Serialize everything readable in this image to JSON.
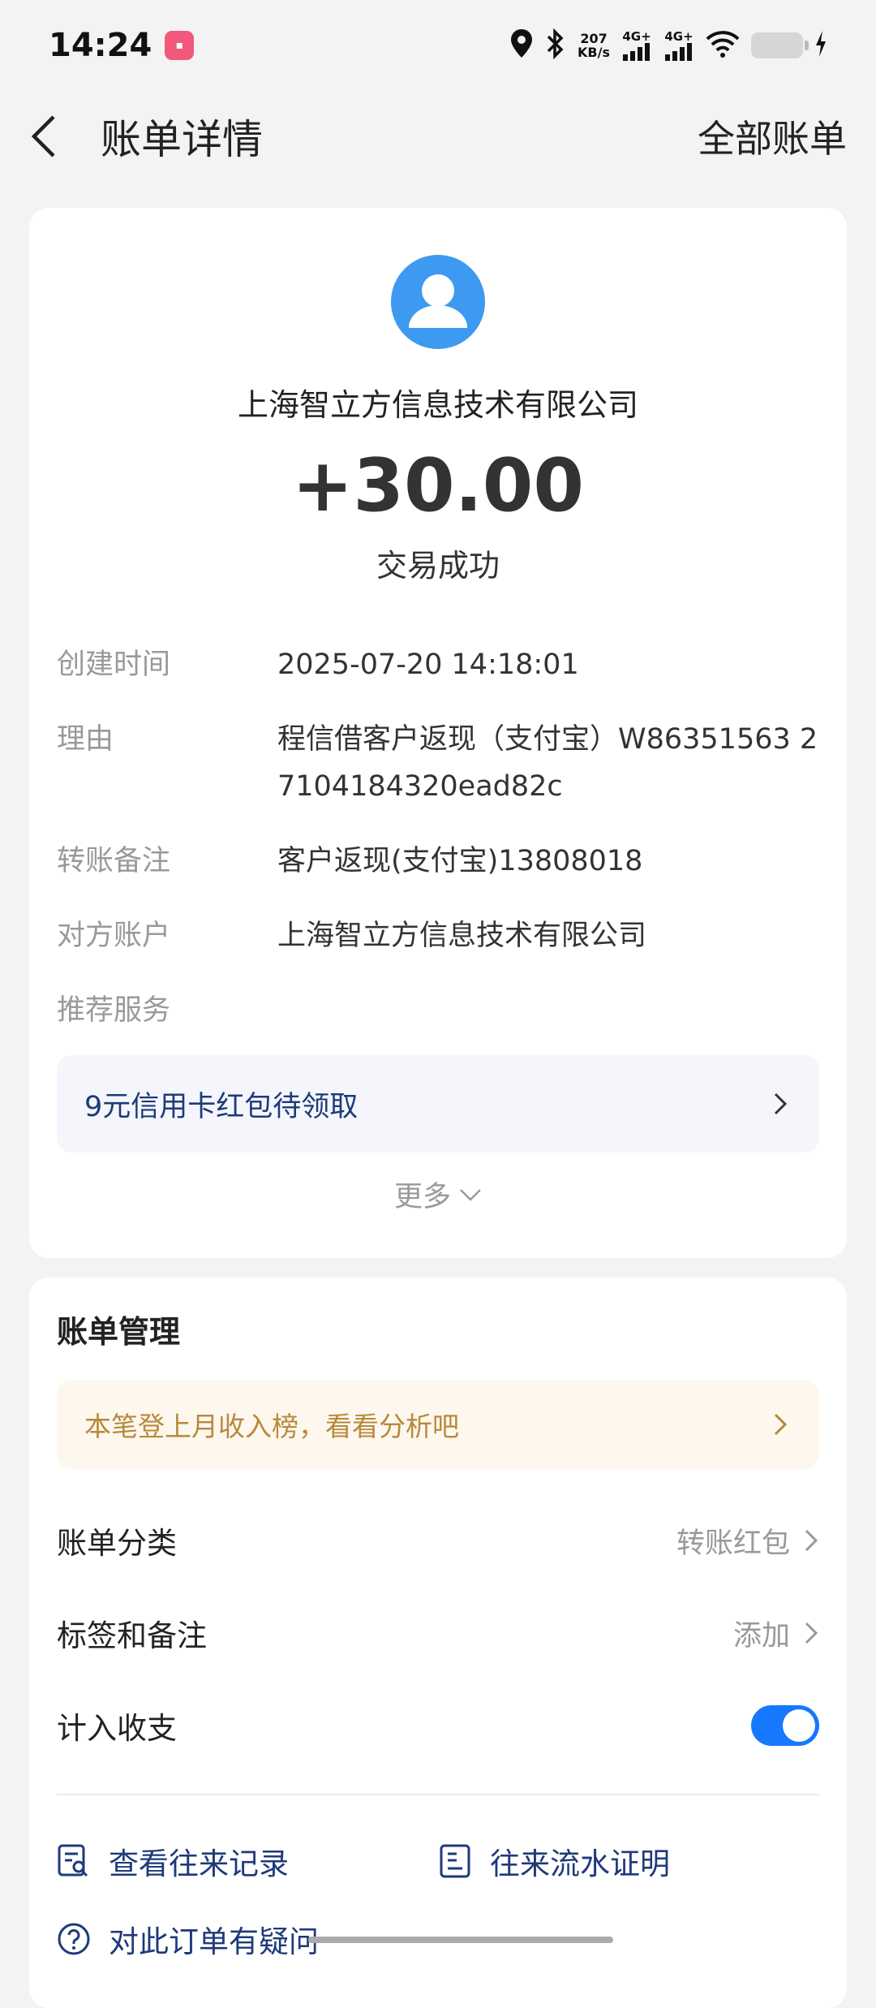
{
  "status_bar": {
    "time": "14:24",
    "net_speed_value": "207",
    "net_speed_unit": "KB/s",
    "net_type_1": "4G+",
    "net_type_2": "4G+"
  },
  "nav": {
    "title": "账单详情",
    "right_link": "全部账单"
  },
  "transaction": {
    "payee": "上海智立方信息技术有限公司",
    "amount": "+30.00",
    "status": "交易成功"
  },
  "details": [
    {
      "label": "创建时间",
      "value": "2025-07-20 14:18:01"
    },
    {
      "label": "理由",
      "value": "程信借客户返现（支付宝）W86351563 27104184320ead82c"
    },
    {
      "label": "转账备注",
      "value": "客户返现(支付宝)13808018"
    },
    {
      "label": "对方账户",
      "value": "上海智立方信息技术有限公司"
    },
    {
      "label": "推荐服务",
      "value": ""
    }
  ],
  "promo": {
    "text": "9元信用卡红包待领取"
  },
  "more": {
    "label": "更多"
  },
  "bill_management": {
    "title": "账单管理",
    "analysis_text": "本笔登上月收入榜，看看分析吧",
    "category_label": "账单分类",
    "category_value": "转账红包",
    "tags_label": "标签和备注",
    "tags_value": "添加",
    "include_label": "计入收支",
    "include_enabled": true,
    "links": {
      "history": "查看往来记录",
      "proof": "往来流水证明",
      "question": "对此订单有疑问"
    }
  },
  "colors": {
    "accent": "#1677ff",
    "avatar": "#3d9af0",
    "promo_text": "#1e3a7a",
    "analysis_text": "#b8893c"
  }
}
